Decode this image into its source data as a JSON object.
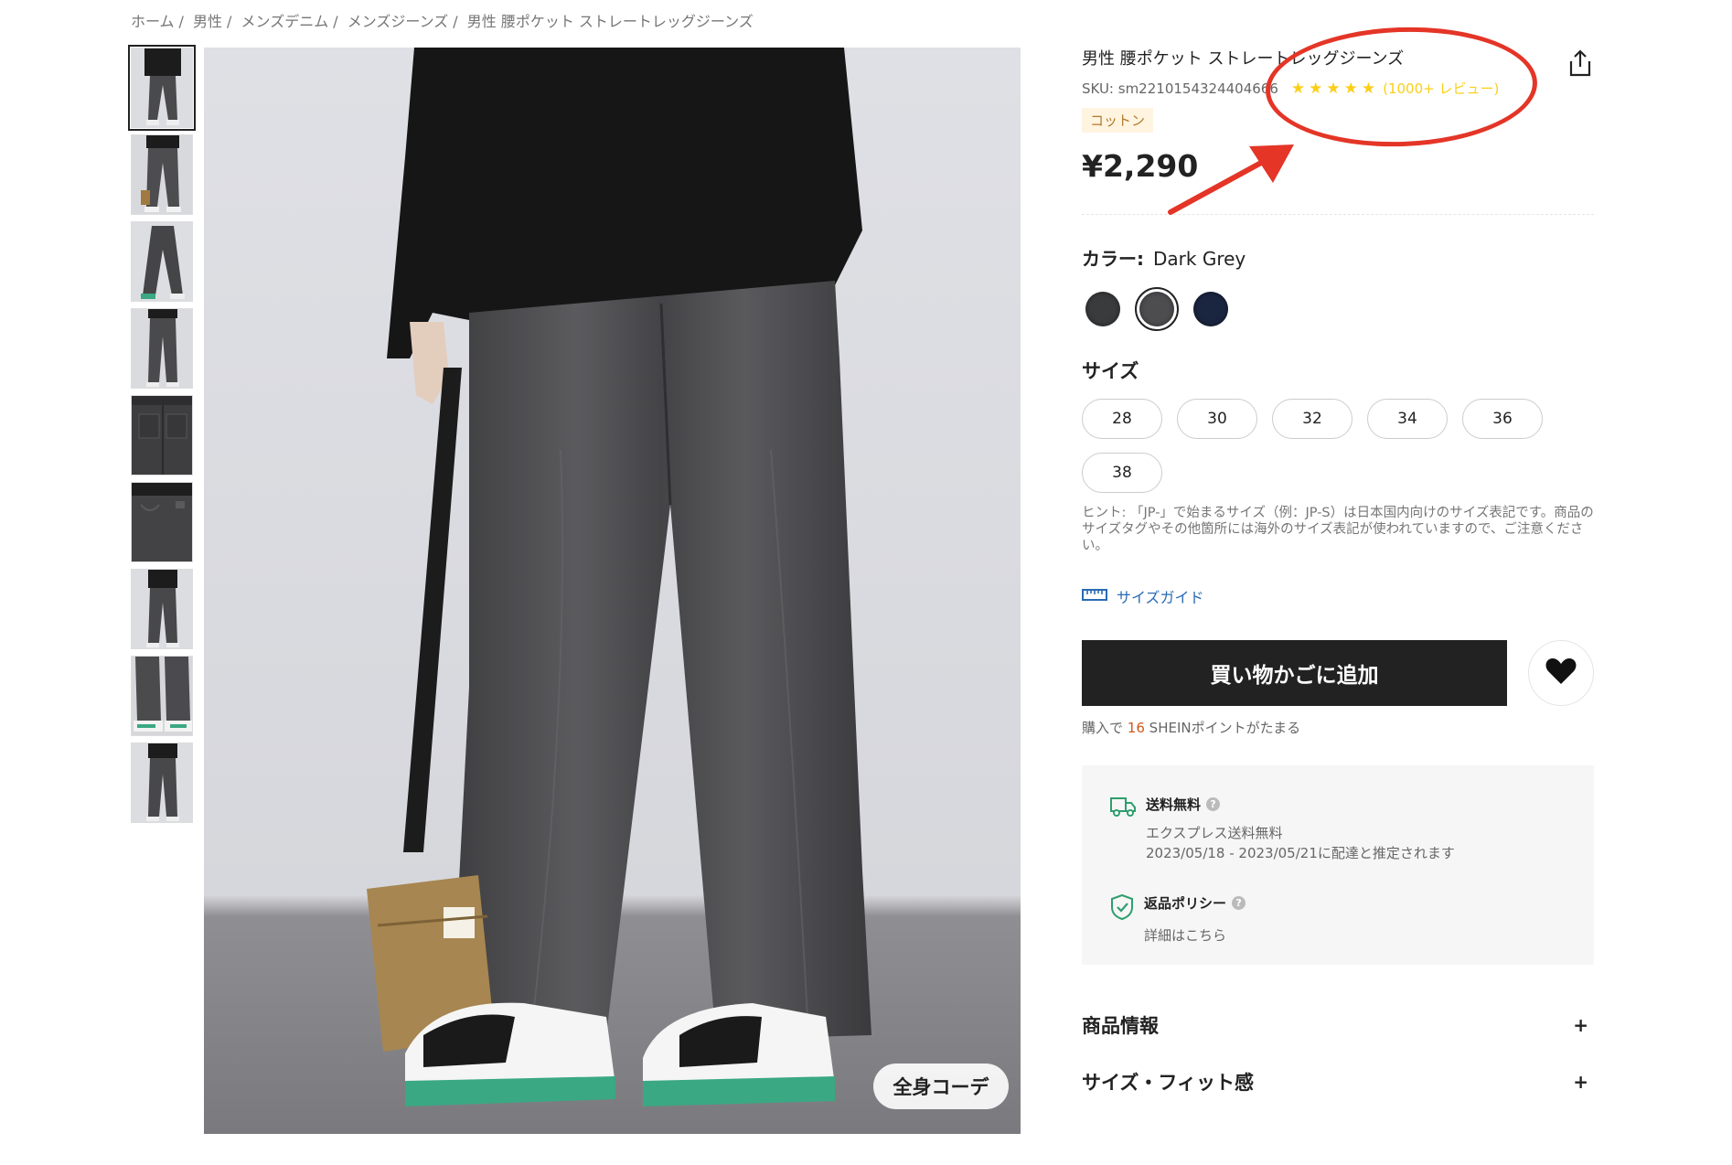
{
  "breadcrumb": [
    "ホーム",
    "男性",
    "メンズデニム",
    "メンズジーンズ",
    "男性 腰ポケット ストレートレッグジーンズ"
  ],
  "product": {
    "title": "男性 腰ポケット ストレートレッグジーンズ",
    "sku": "SKU: sm2210154324404666",
    "rating_stars": "★★★★★",
    "rating_value": 4.5,
    "reviews": "(1000+ レビュー)",
    "material_tag": "コットン",
    "price": "¥2,290"
  },
  "color": {
    "label": "カラー:",
    "selected": "Dark Grey",
    "swatches": [
      {
        "name": "Black Grey",
        "hex": "#3a3b3d"
      },
      {
        "name": "Dark Grey",
        "hex": "#4d4d50"
      },
      {
        "name": "Navy",
        "hex": "#1a2540"
      }
    ]
  },
  "size": {
    "label": "サイズ",
    "options": [
      "28",
      "30",
      "32",
      "34",
      "36",
      "38"
    ],
    "hint": "ヒント: 「JP-」で始まるサイズ（例：JP-S）は日本国内向けのサイズ表記です。商品のサイズタグやその他箇所には海外のサイズ表記が使われていますので、ご注意ください。",
    "guide": "サイズガイド"
  },
  "actions": {
    "add_to_cart": "買い物かごに追加"
  },
  "points": {
    "prefix": "購入で",
    "value": "16",
    "suffix": "SHEINポイントがたまる"
  },
  "shipping": {
    "title": "送料無料",
    "line1": "エクスプレス送料無料",
    "line2": "2023/05/18 - 2023/05/21に配達と推定されます"
  },
  "returns": {
    "title": "返品ポリシー",
    "link": "詳細はこちら"
  },
  "accordions": [
    {
      "label": "商品情報",
      "icon": "+"
    },
    {
      "label": "サイズ・フィット感",
      "icon": "+"
    }
  ],
  "image": {
    "outfit_button": "全身コーデ",
    "thumbnails_count": 9
  },
  "colors": {
    "accent_star": "#facf19",
    "annotation": "#e43527",
    "link": "#2a6bb3",
    "cart_button": "#222222"
  }
}
